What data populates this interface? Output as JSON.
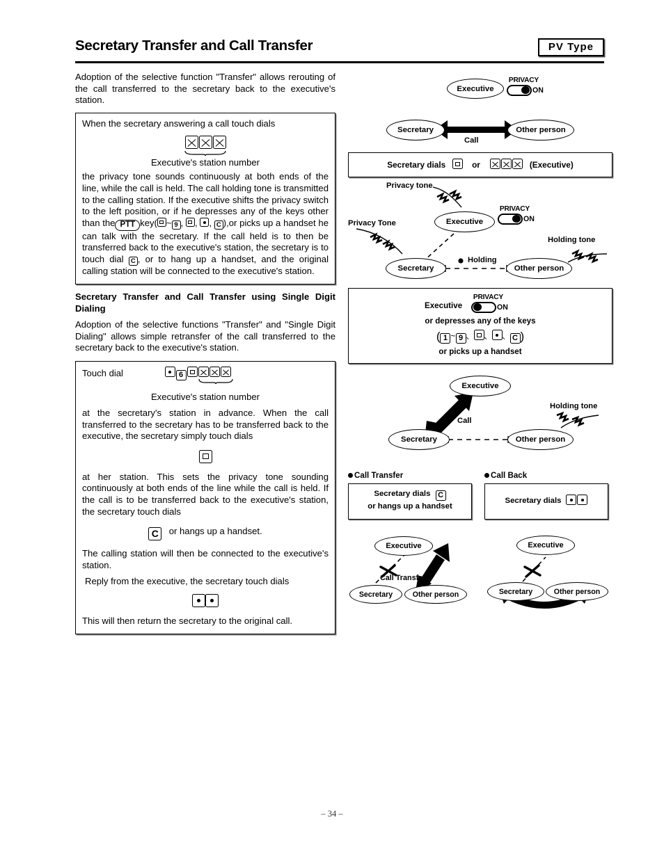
{
  "header": {
    "title": "Secretary Transfer and Call Transfer",
    "badge": "PV  Type"
  },
  "left_column": {
    "intro_paragraph": "Adoption of the selective function \"Transfer\" allows rerouting of the call transferred to the secretary back to the executive's station.",
    "box1": {
      "lead_line": "When the secretary answering a call touch dials",
      "keys": [
        "X",
        "X",
        "X"
      ],
      "key_caption": "Executive's station number",
      "body": "the privacy tone sounds continuously at both ends of the line, while the call is held. The call holding tone is transmitted to the calling station. If the executive shifts the privacy switch to the left position, or if he depresses any of the keys other than the",
      "ptt_label": "PTT",
      "inline_key_prefix": "key(",
      "inline_keys": [
        "0",
        "~",
        "9",
        ",",
        "0",
        ",",
        "•",
        ",",
        "C"
      ],
      "inline_key_suffix": "),or",
      "body_cont": "picks up a handset he can talk with the secretary. If the call held is to then be transferred back to the executive's station, the secretary is to touch dial",
      "dial_key": "C",
      "body_end": ", or to hang up a handset, and the original calling station will be connected to the executive's station."
    },
    "sub_heading": "Secretary Transfer and Call Transfer using Single Digit Dialing",
    "paragraph2": "Adoption of the selective functions \"Transfer\" and \"Single Digit Dialing\" allows simple retransfer of the call transferred to the secretary back to the executive's station.",
    "box2": {
      "lead_label": "Touch dial",
      "keys": [
        "•",
        "6",
        "0",
        "X",
        "X",
        "X"
      ],
      "key_caption": "Executive's station number",
      "para1": "at the secretary's station in advance. When the call transferred to the secretary has to be transferred back to the executive, the secretary simply touch dials",
      "center_key": "0",
      "para2": "at her station. This sets the privacy tone sounding continuously at both ends of the line while the call is held. If the call is to be transferred back to the executive's station, the secretary touch dials",
      "hangup_key": "C",
      "hangup_text": "or hangs up a handset.",
      "para3": "The calling station will then be connected to the executive's station.",
      "para4": "Reply from the executive, the secretary touch dials",
      "reply_keys": [
        "•",
        "•"
      ],
      "para5": "This will then return the secretary to the original call."
    }
  },
  "right_column": {
    "diagram1": {
      "executive": "Executive",
      "secretary": "Secretary",
      "other_person": "Other person",
      "call_label": "Call",
      "privacy_label": "PRIVACY",
      "privacy_state": "ON",
      "privacy_knob": "right"
    },
    "box_secretary_dials": {
      "prefix": "Secretary dials",
      "key1": "0",
      "or": "or",
      "keys": [
        "X",
        "X",
        "X"
      ],
      "suffix": "(Executive)"
    },
    "diagram2": {
      "executive": "Executive",
      "secretary": "Secretary",
      "other_person": "Other person",
      "privacy_tone_top": "Privacy tone",
      "privacy_tone_left": "Privacy Tone",
      "holding_tone": "Holding tone",
      "holding_label": "Holding",
      "privacy_label": "PRIVACY",
      "privacy_state": "ON",
      "privacy_knob": "right"
    },
    "box_executive_keys": {
      "executive": "Executive",
      "privacy_label": "PRIVACY",
      "privacy_state": "ON",
      "privacy_knob": "left",
      "line2": "or depresses any of the keys",
      "keys": [
        "1",
        "~",
        "9",
        "、",
        "0",
        "、",
        "•",
        "、",
        "C"
      ],
      "line4": "or picks up a handset"
    },
    "diagram3": {
      "executive": "Executive",
      "secretary": "Secretary",
      "other_person": "Other person",
      "call_label": "Call",
      "holding_tone": "Holding tone"
    },
    "call_transfer": {
      "heading": "Call Transfer",
      "box_line1_prefix": "Secretary dials",
      "box_line1_key": "C",
      "box_line2": "or hangs up a handset",
      "executive": "Executive",
      "secretary": "Secretary",
      "other_person": "Other person",
      "edge_label": "Call Transfer"
    },
    "call_back": {
      "heading": "Call Back",
      "box_line1_prefix": "Secretary dials",
      "box_keys": [
        "•",
        "•"
      ],
      "executive": "Executive",
      "secretary": "Secretary",
      "other_person": "Other person"
    }
  },
  "footer": {
    "page_number": "– 34 –"
  }
}
